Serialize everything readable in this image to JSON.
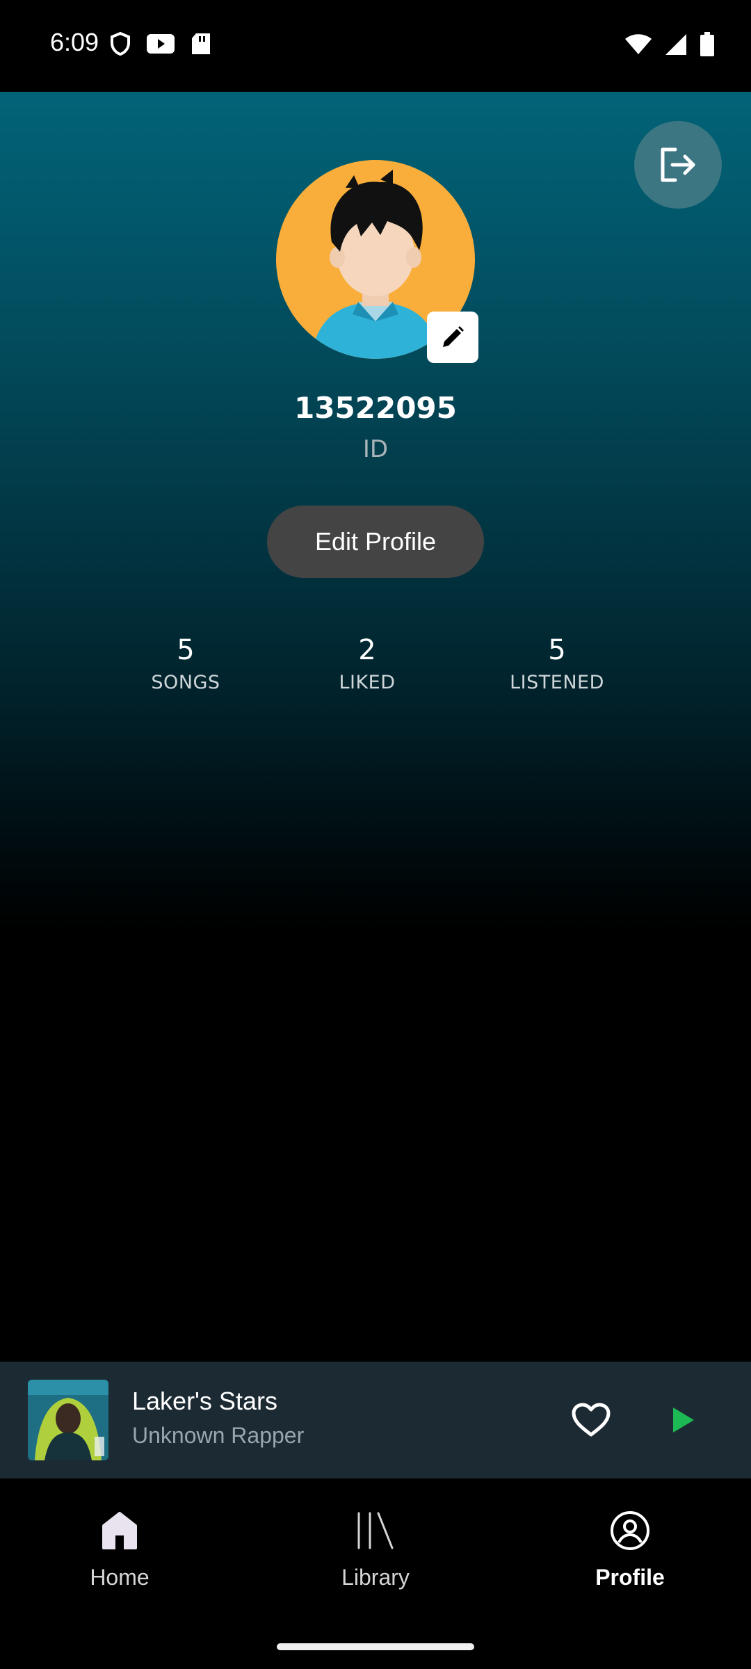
{
  "status_bar": {
    "time": "6:09",
    "left_icons": [
      "shield-icon",
      "youtube-icon",
      "sd-card-icon"
    ],
    "right_icons": [
      "wifi-icon",
      "signal-icon",
      "battery-icon"
    ]
  },
  "profile": {
    "username": "13522095",
    "subtitle": "ID",
    "edit_button_label": "Edit Profile"
  },
  "stats": [
    {
      "value": "5",
      "label": "SONGS"
    },
    {
      "value": "2",
      "label": "LIKED"
    },
    {
      "value": "5",
      "label": "LISTENED"
    }
  ],
  "now_playing": {
    "title": "Laker's Stars",
    "artist": "Unknown Rapper",
    "liked": false,
    "play_color": "#1db954"
  },
  "bottom_nav": {
    "items": [
      {
        "label": "Home",
        "icon": "home-icon",
        "active": false
      },
      {
        "label": "Library",
        "icon": "library-icon",
        "active": false
      },
      {
        "label": "Profile",
        "icon": "profile-icon",
        "active": true
      }
    ]
  },
  "colors": {
    "accent_gradient_top": "#026378",
    "avatar_bg": "#f9ae3b",
    "now_playing_bg": "#1c2a33"
  }
}
